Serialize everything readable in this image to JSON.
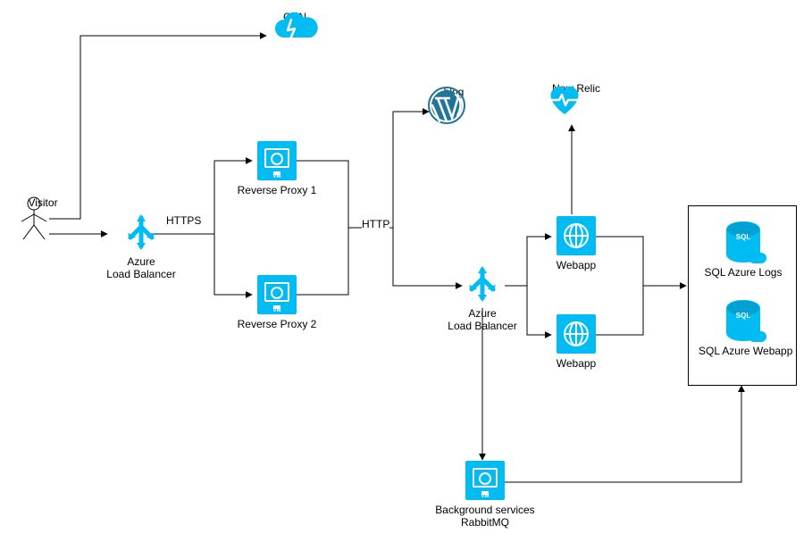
{
  "nodes": {
    "visitor": "Visitor",
    "cdn": "CDN",
    "lb1": "Azure\nLoad Balancer",
    "proxy1": "Reverse Proxy 1",
    "proxy2": "Reverse Proxy 2",
    "blog": "blog",
    "lb2": "Azure\nLoad Balancer",
    "newrelic": "New Relic",
    "webapp1": "Webapp",
    "webapp2": "Webapp",
    "bg": "Background services\nRabbitMQ",
    "sqllogs": "SQL Azure Logs",
    "sqlwebapp": "SQL Azure Webapp"
  },
  "edges": {
    "https": "HTTPS",
    "http": "HTTP"
  },
  "vm_tag": "VM"
}
